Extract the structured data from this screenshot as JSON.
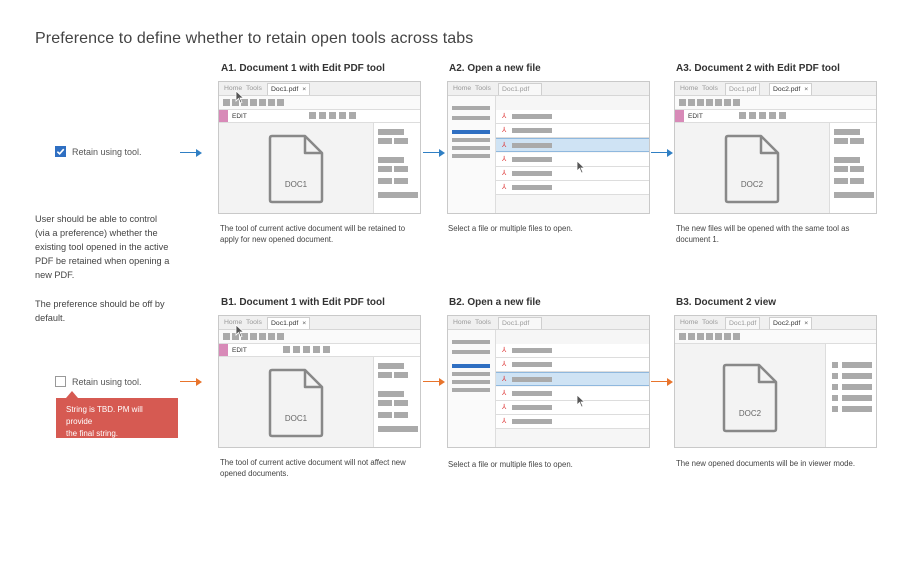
{
  "title": "Preference to define whether to retain open tools across tabs",
  "left": {
    "checkbox_checked": {
      "label": "Retain using tool.",
      "checked": true
    },
    "checkbox_unchecked": {
      "label": "Retain using tool.",
      "checked": false
    },
    "note1": [
      "User should be able to control",
      "(via a preference) whether the",
      "existing tool opened in the active",
      "PDF be retained when opening a",
      "new PDF."
    ],
    "note2": [
      "The preference should be off by",
      "default."
    ],
    "tbd": [
      "String is TBD. PM will provide",
      "the final string."
    ]
  },
  "tabs": {
    "home": "Home",
    "tools": "Tools",
    "doc1": "Doc1.pdf",
    "doc2": "Doc2.pdf",
    "close": "×"
  },
  "edit_label": "EDIT",
  "doc_labels": {
    "doc1": "DOC1",
    "doc2": "DOC2"
  },
  "pdf_glyph": "⅄",
  "rowA": {
    "a1": {
      "heading": "A1. Document 1 with Edit PDF tool",
      "caption": [
        "The tool of current active document will be retained to",
        "apply for new opened document."
      ]
    },
    "a2": {
      "heading": "A2. Open a new file",
      "caption": [
        "Select a file or multiple files to open."
      ]
    },
    "a3": {
      "heading": "A3. Document 2 with Edit PDF tool",
      "caption": [
        "The new files will be opened with the same tool as",
        "document 1."
      ]
    }
  },
  "rowB": {
    "b1": {
      "heading": "B1. Document 1 with Edit PDF tool",
      "caption": [
        "The tool of current active document will not affect new",
        "opened documents."
      ]
    },
    "b2": {
      "heading": "B2. Open a new file",
      "caption": [
        "Select a file or multiple files to open."
      ]
    },
    "b3": {
      "heading": "B3. Document 2 view",
      "caption": [
        "The new opened documents will be in viewer mode."
      ]
    }
  },
  "colors": {
    "blue_arrow": "#2f7fc4",
    "orange_arrow": "#e8742c",
    "checkbox": "#2f6fc2",
    "tbd_box": "#d65a52",
    "edit_tool": "#d88ab8",
    "selection": "#cfe3f4"
  }
}
